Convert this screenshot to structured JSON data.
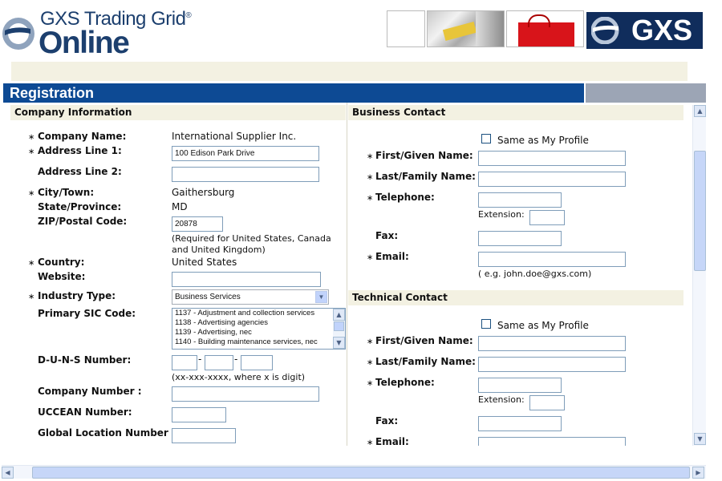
{
  "header": {
    "logo_line1": "GXS Trading Grid",
    "logo_reg": "®",
    "logo_line2": "Online",
    "brand": "GXS"
  },
  "page_title": "Registration",
  "company": {
    "title": "Company Information",
    "company_name": {
      "label": "Company Name:",
      "value": "International Supplier Inc."
    },
    "address1": {
      "label": "Address Line 1:",
      "value": "100 Edison Park Drive"
    },
    "address2": {
      "label": "Address Line 2:",
      "value": ""
    },
    "city": {
      "label": "City/Town:",
      "value": "Gaithersburg"
    },
    "state": {
      "label": "State/Province:",
      "value": "MD"
    },
    "zip": {
      "label": "ZIP/Postal Code:",
      "value": "20878",
      "note": "(Required for United States, Canada and United Kingdom)"
    },
    "country": {
      "label": "Country:",
      "value": "United States"
    },
    "website": {
      "label": "Website:",
      "value": ""
    },
    "industry": {
      "label": "Industry Type:",
      "value": "Business Services"
    },
    "sic": {
      "label": "Primary SIC Code:",
      "options": [
        "1137 - Adjustment and collection services",
        "1138 - Advertising agencies",
        "1139 - Advertising, nec",
        "1140 - Building maintenance services, nec"
      ]
    },
    "duns": {
      "label": "D-U-N-S Number:",
      "sep": "-",
      "note": "(xx-xxx-xxxx, where x is digit)"
    },
    "company_number": {
      "label": "Company Number :"
    },
    "uccean": {
      "label": "UCCEAN Number:"
    },
    "gln": {
      "label": "Global Location Number :"
    }
  },
  "business_contact": {
    "title": "Business Contact",
    "same_as_profile": "Same as My Profile",
    "first_name": "First/Given Name:",
    "last_name": "Last/Family Name:",
    "telephone": "Telephone:",
    "extension": "Extension:",
    "fax": "Fax:",
    "email": "Email:",
    "email_hint": "( e.g. john.doe@gxs.com)"
  },
  "technical_contact": {
    "title": "Technical Contact",
    "same_as_profile": "Same as My Profile",
    "first_name": "First/Given Name:",
    "last_name": "Last/Family Name:",
    "telephone": "Telephone:",
    "extension": "Extension:",
    "fax": "Fax:",
    "email": "Email:"
  },
  "required_mark": "∗",
  "colors": {
    "brand_blue": "#0d4a94",
    "section_bg": "#f3f1e2",
    "logo_navy": "#1c3f6e"
  }
}
